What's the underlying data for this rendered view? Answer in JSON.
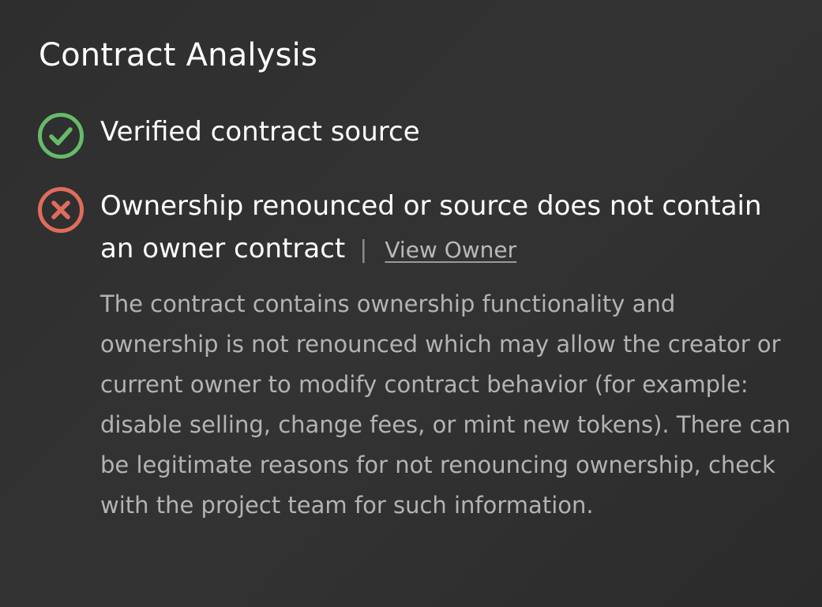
{
  "section": {
    "title": "Contract Analysis"
  },
  "checks": [
    {
      "status": "pass",
      "icon": "check-circle-icon",
      "color": "#66bb6a",
      "label": "Verified contract source"
    },
    {
      "status": "fail",
      "icon": "x-circle-icon",
      "color": "#e06c5c",
      "label": "Ownership renounced or source does not contain an owner contract",
      "separator": "|",
      "link_label": "View Owner",
      "description": "The contract contains ownership functionality and ownership is not renounced which may allow the creator or current owner to modify contract behavior (for example: disable selling, change fees, or mint new tokens). There can be legitimate reasons for not renouncing ownership, check with the project team for such information."
    }
  ]
}
